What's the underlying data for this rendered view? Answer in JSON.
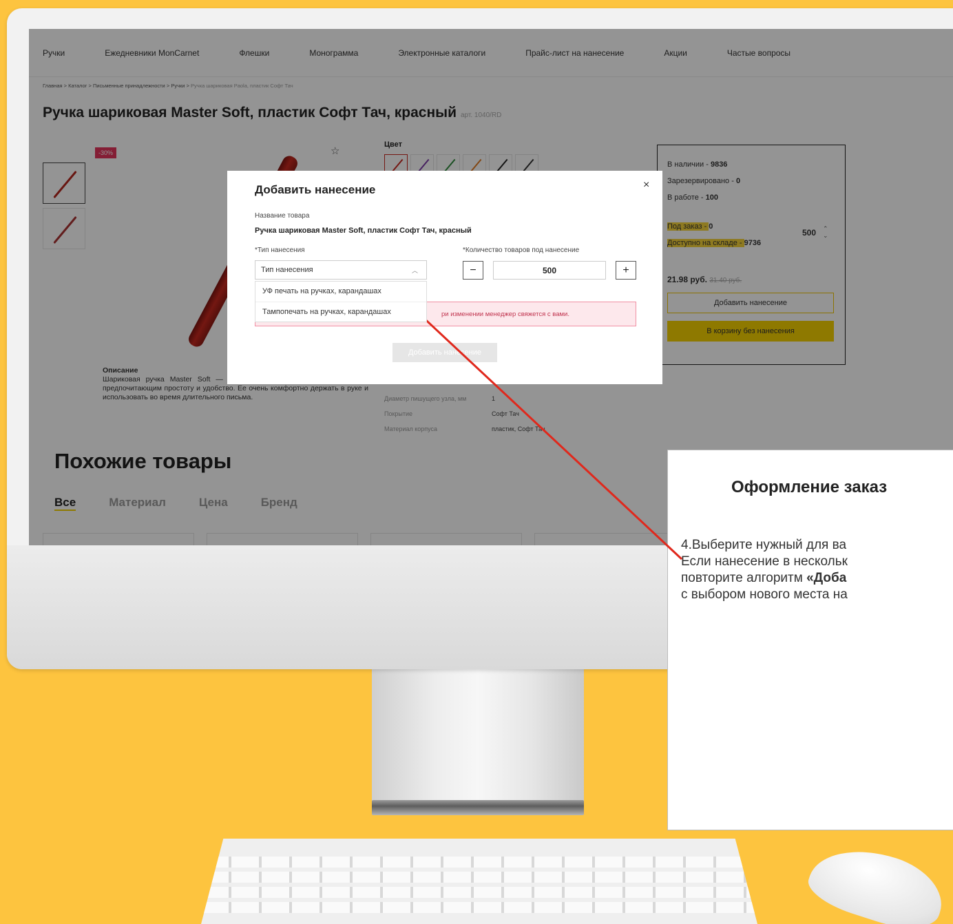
{
  "nav": {
    "items": [
      "Ручки",
      "Ежедневники MonCarnet",
      "Флешки",
      "Монограмма",
      "Электронные каталоги",
      "Прайс-лист на нанесение",
      "Акции",
      "Частые вопросы"
    ]
  },
  "breadcrumb": {
    "items": [
      "Главная",
      "Каталог",
      "Письменные принадлежности",
      "Ручки"
    ],
    "current": "Ручка шариковая Paola, пластик Софт Тач",
    "separator": ">"
  },
  "product": {
    "title": "Ручка шариковая Master Soft, пластик Софт Тач, красный",
    "article": "арт. 1040/RD",
    "discount_badge": "-30%",
    "color_label": "Цвет",
    "swatch_colors": [
      "#c8291f",
      "#7b3aa5",
      "#2f8a3c",
      "#e07a22",
      "#222222",
      "#333333"
    ],
    "description_heading": "Описание",
    "description_text": "Шариковая ручка Master Soft — инструмент, который подойдет людям, предпочитающим простоту и удобство. Ее очень комфортно держать в руке и использовать во время длительного письма.",
    "specs": [
      {
        "key": "Диаметр пишущего узла, мм",
        "value": "1"
      },
      {
        "key": "Покрытие",
        "value": "Софт Тач"
      },
      {
        "key": "Материал корпуса",
        "value": "пластик, Софт Тач"
      }
    ]
  },
  "stock": {
    "in_stock_label": "В наличии - ",
    "in_stock": "9836",
    "reserved_label": "Зарезервировано - ",
    "reserved": "0",
    "in_work_label": "В работе - ",
    "in_work": "100",
    "on_order_label": "Под заказ - ",
    "on_order": "0",
    "available_label": "Доступно на складе - ",
    "available": "9736",
    "quantity": "500",
    "price": "21.98 руб.",
    "old_price": "31.40 руб.",
    "add_print_button": "Добавить нанесение",
    "cart_button": "В корзину без нанесения"
  },
  "similar": {
    "title": "Похожие товары",
    "tabs": [
      "Все",
      "Материал",
      "Цена",
      "Бренд"
    ]
  },
  "modal": {
    "title": "Добавить нанесение",
    "product_name_label": "Название товара",
    "product_name": "Ручка шариковая Master Soft, пластик Софт Тач, красный",
    "print_type_label": "*Тип нанесения",
    "print_type_placeholder": "Тип нанесения",
    "print_type_options": [
      "УФ печать на ручках, карандашах",
      "Тампопечать на ручках, карандашах"
    ],
    "quantity_label": "*Количество товаров под нанесение",
    "quantity": "500",
    "minus": "−",
    "plus": "+",
    "alert_text": "ри изменении менеджер свяжется с вами.",
    "submit_button": "Добавить нанесение",
    "close_symbol": "×"
  },
  "instruction": {
    "title": "Оформление заказ",
    "line1": "4.Выберите нужный для ва",
    "line2": "Если нанесение в нескольк",
    "line3_prefix": "повторите алгоритм ",
    "line3_bold": "«Доба",
    "line4": "с выбором нового места на"
  },
  "colors": {
    "background": "#fdc43f",
    "accent_yellow": "#f4d000",
    "arrow_red": "#e0281c",
    "alert_pink": "#fde8ec"
  }
}
